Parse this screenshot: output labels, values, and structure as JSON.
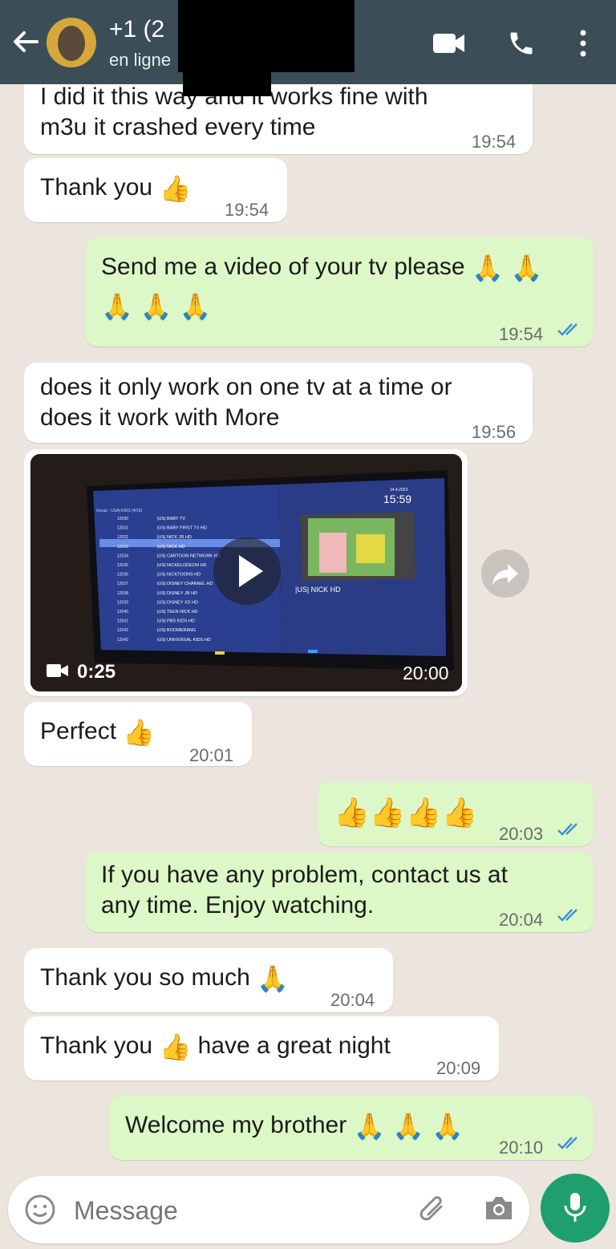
{
  "header": {
    "contact_name": "+1 (2",
    "status": "en ligne"
  },
  "messages": [
    {
      "dir": "in",
      "lines": [
        "I did it this way and it works fine with",
        "m3u it crashed every time"
      ],
      "time": "19:54"
    },
    {
      "dir": "in",
      "text": "Thank you",
      "emoji": "👍",
      "time": "19:54"
    },
    {
      "dir": "out",
      "line1": "Send me a video of your tv please",
      "line1_emoji": "🙏 🙏",
      "line2_emoji": "🙏 🙏 🙏",
      "time": "19:54"
    },
    {
      "dir": "in",
      "lines": [
        "does it only work on one tv at a time or",
        "does it work with More"
      ],
      "time": "19:56"
    },
    {
      "dir": "in",
      "text": "Perfect",
      "emoji": "👍",
      "time": "20:01"
    },
    {
      "dir": "out",
      "emoji": "👍👍👍👍",
      "time": "20:03"
    },
    {
      "dir": "out",
      "lines": [
        "If you have any problem, contact us at",
        "any time. Enjoy watching."
      ],
      "time": "20:04"
    },
    {
      "dir": "in",
      "text": "Thank you so much",
      "emoji": "🙏",
      "time": "20:04"
    },
    {
      "dir": "in",
      "text": "Thank you",
      "emoji": "👍",
      "text2": "have a great night",
      "time": "20:09"
    },
    {
      "dir": "out",
      "text": "Welcome my brother",
      "emoji": "🙏 🙏 🙏",
      "time": "20:10"
    }
  ],
  "video_message": {
    "duration": "0:25",
    "time": "20:00",
    "screen_clock": "15:59",
    "screen_date": "14.4.2023",
    "channel_label": "|US| NICK HD",
    "group_label": "Group : USA| KIDS (4/15)",
    "channels": [
      {
        "num": "12030",
        "name": "|US| BABY TV"
      },
      {
        "num": "12031",
        "name": "|US| BABY FIRST TV HD"
      },
      {
        "num": "12032",
        "name": "|US| NICK JR HD"
      },
      {
        "num": "12033",
        "name": "|US| NICK HD"
      },
      {
        "num": "12034",
        "name": "|US| CARTOON NETWORK HD"
      },
      {
        "num": "12035",
        "name": "|US| NICKELODEON HD"
      },
      {
        "num": "12036",
        "name": "|US| NICKTOONS HD"
      },
      {
        "num": "12037",
        "name": "|US| DISNEY CHANNEL HD"
      },
      {
        "num": "12038",
        "name": "|US| DISNEY JR HD"
      },
      {
        "num": "12039",
        "name": "|US| DISNEY XD HD"
      },
      {
        "num": "12040",
        "name": "|US| TEEN NICK HD"
      },
      {
        "num": "12041",
        "name": "|US| PBS KIDS HD"
      },
      {
        "num": "12042",
        "name": "|US| BOOMERANG"
      },
      {
        "num": "12043",
        "name": "|US| UNIVERSAL KIDS HD"
      }
    ]
  },
  "composer": {
    "placeholder": "Message"
  },
  "colors": {
    "header": "#3b4e57",
    "outgoing": "#dcf8c6",
    "incoming": "#ffffff",
    "tick": "#34b7f1",
    "mic": "#1e9f6d"
  }
}
